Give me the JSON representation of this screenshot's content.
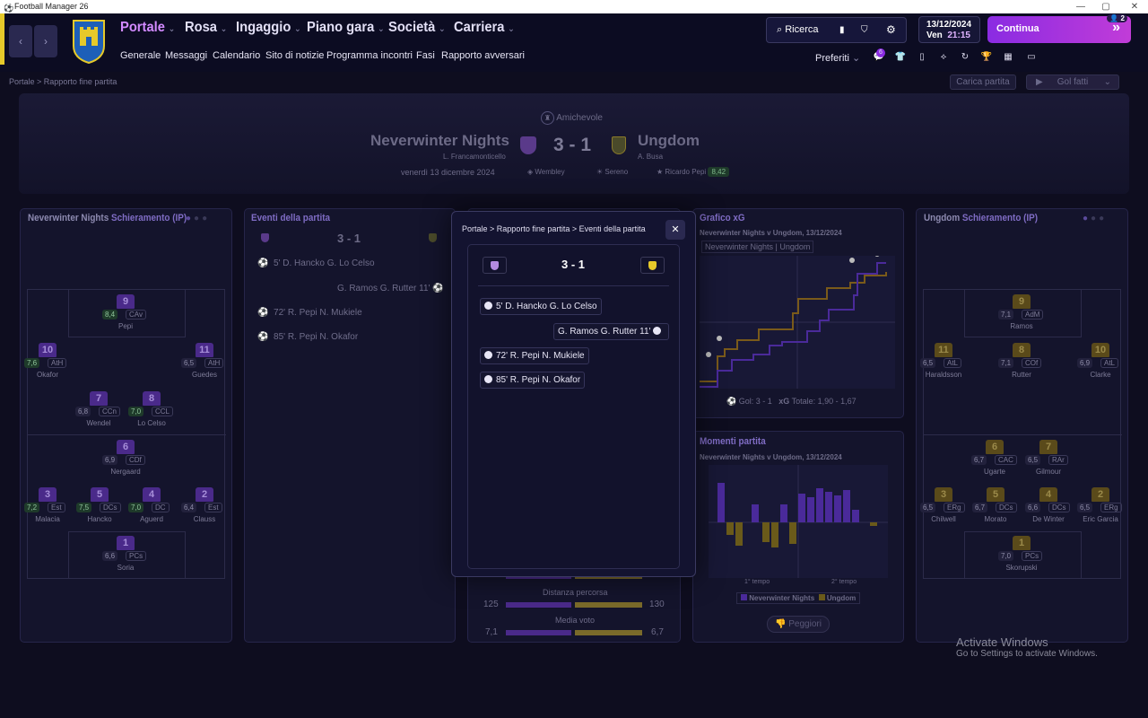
{
  "window": {
    "title": "Football Manager 26"
  },
  "nav": {
    "menus": [
      "Portale",
      "Rosa",
      "Ingaggio",
      "Piano gara",
      "Società",
      "Carriera"
    ],
    "submenu": [
      "Generale",
      "Messaggi",
      "Calendario",
      "Sito di notizie",
      "Programma incontri",
      "Fasi",
      "Rapporto avversari"
    ],
    "search": "Ricerca",
    "preferiti": "Preferiti",
    "badge_count": "2",
    "fav_badge": "6",
    "date": "13/12/2024",
    "day": "Ven",
    "time": "21:15",
    "continue": "Continua"
  },
  "breadcrumb": {
    "a": "Portale",
    "b": "Rapporto fine partita"
  },
  "actions": {
    "load_match": "Carica partita",
    "goals": "Gol fatti"
  },
  "match": {
    "competition": "Amichevole",
    "home": "Neverwinter Nights",
    "home_manager": "L. Francamonticello",
    "score": "3 - 1",
    "away": "Ungdom",
    "away_manager": "A. Busa",
    "date": "venerdì 13 dicembre 2024",
    "stadium": "Wembley",
    "weather": "Sereno",
    "potm": "Ricardo Pepi",
    "potm_rating": "8,42"
  },
  "home_lineup": {
    "title_team": "Neverwinter Nights",
    "title_suffix": "Schieramento (IP)",
    "players": [
      {
        "n": "9",
        "r": "8,4",
        "p": "CAv",
        "name": "Pepi",
        "good": true
      },
      {
        "n": "10",
        "r": "7,6",
        "p": "AtH",
        "name": "Okafor",
        "good": true
      },
      {
        "n": "11",
        "r": "6,5",
        "p": "AtH",
        "name": "Guedes",
        "good": false
      },
      {
        "n": "7",
        "r": "6,8",
        "p": "CCn",
        "name": "Wendel",
        "good": false
      },
      {
        "n": "8",
        "r": "7,0",
        "p": "CCL",
        "name": "Lo Celso",
        "good": true
      },
      {
        "n": "6",
        "r": "6,9",
        "p": "CDf",
        "name": "Nergaard",
        "good": false
      },
      {
        "n": "3",
        "r": "7,2",
        "p": "Est",
        "name": "Malacia",
        "good": true
      },
      {
        "n": "5",
        "r": "7,5",
        "p": "DCs",
        "name": "Hancko",
        "good": true
      },
      {
        "n": "4",
        "r": "7,0",
        "p": "DC",
        "name": "Aguerd",
        "good": true
      },
      {
        "n": "2",
        "r": "6,4",
        "p": "Est",
        "name": "Clauss",
        "good": false
      },
      {
        "n": "1",
        "r": "6,6",
        "p": "PCs",
        "name": "Soria",
        "good": false
      }
    ]
  },
  "away_lineup": {
    "title_team": "Ungdom",
    "title_suffix": "Schieramento (IP)",
    "players": [
      {
        "n": "9",
        "r": "7,1",
        "p": "AdM",
        "name": "Ramos"
      },
      {
        "n": "11",
        "r": "6,5",
        "p": "AtL",
        "name": "Haraldsson"
      },
      {
        "n": "8",
        "r": "7,1",
        "p": "COf",
        "name": "Rutter"
      },
      {
        "n": "10",
        "r": "6,9",
        "p": "AtL",
        "name": "Clarke"
      },
      {
        "n": "6",
        "r": "6,7",
        "p": "CAC",
        "name": "Ugarte"
      },
      {
        "n": "7",
        "r": "6,5",
        "p": "RAr",
        "name": "Gilmour"
      },
      {
        "n": "3",
        "r": "6,5",
        "p": "ERg",
        "name": "Chilwell"
      },
      {
        "n": "5",
        "r": "6,7",
        "p": "DCs",
        "name": "Morato"
      },
      {
        "n": "4",
        "r": "6,6",
        "p": "DCs",
        "name": "De Winter"
      },
      {
        "n": "2",
        "r": "6,5",
        "p": "ERg",
        "name": "Eric Garcia"
      },
      {
        "n": "1",
        "r": "7,0",
        "p": "PCs",
        "name": "Skorupski"
      }
    ]
  },
  "events_panel": {
    "title": "Eventi della partita",
    "score": "3 - 1",
    "events": [
      {
        "side": "home",
        "text": "5' D. Hancko G. Lo Celso"
      },
      {
        "side": "away",
        "text": "G. Ramos G. Rutter 11'"
      },
      {
        "side": "home",
        "text": "72' R. Pepi N. Mukiele"
      },
      {
        "side": "home",
        "text": "85' R. Pepi N. Okafor"
      }
    ]
  },
  "stats": {
    "distance_label": "Distanza percorsa",
    "distance_home": "125",
    "distance_away": "130",
    "rating_label": "Media voto",
    "rating_home": "7,1",
    "rating_away": "6,7"
  },
  "xg_panel": {
    "title": "Grafico xG",
    "subtitle": "Neverwinter Nights v Ungdom, 13/12/2024",
    "legend_home": "Neverwinter Nights",
    "legend_away": "Ungdom",
    "goals_label": "Gol: 3 - 1",
    "xg_label": "xG",
    "xg_total": "Totale: 1,90 - 1,67"
  },
  "moments_panel": {
    "title": "Momenti partita",
    "subtitle": "Neverwinter Nights v Ungdom, 13/12/2024",
    "first_half": "1° tempo",
    "second_half": "2° tempo",
    "legend_home": "Neverwinter Nights",
    "legend_away": "Ungdom",
    "worst_button": "Peggiori"
  },
  "modal": {
    "crumb1": "Portale",
    "crumb2": "Rapporto fine partita",
    "crumb3": "Eventi della partita",
    "score": "3 - 1"
  },
  "watermark": {
    "line1": "Activate Windows",
    "line2": "Go to Settings to activate Windows."
  },
  "colors": {
    "home": "#6a2fc8",
    "away": "#b49a2a",
    "accent": "#c13cd8"
  }
}
